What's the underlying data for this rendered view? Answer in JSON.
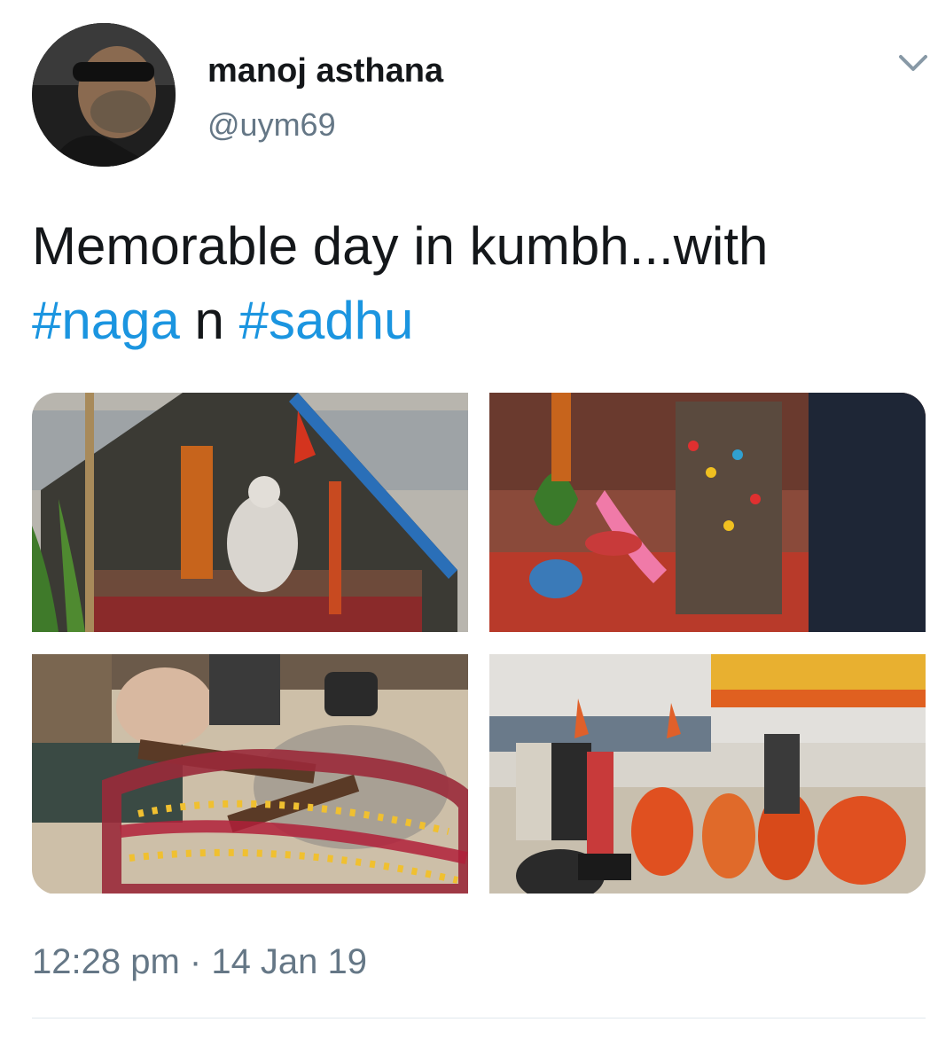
{
  "author": {
    "display_name": "manoj asthana",
    "handle": "@uym69"
  },
  "tweet": {
    "text_before": "Memorable day in kumbh...with ",
    "hashtag_1": "#naga",
    "text_middle": " n ",
    "hashtag_2": "#sadhu"
  },
  "timestamp": {
    "time": "12:28 pm",
    "separator": " · ",
    "date": "14 Jan 19"
  },
  "icons": {
    "menu": "chevron-down-icon",
    "avatar": "profile-photo"
  },
  "colors": {
    "hashtag": "#1b95e0",
    "secondary_text": "#657786",
    "primary_text": "#14171a",
    "divider": "#e1e8ed"
  }
}
